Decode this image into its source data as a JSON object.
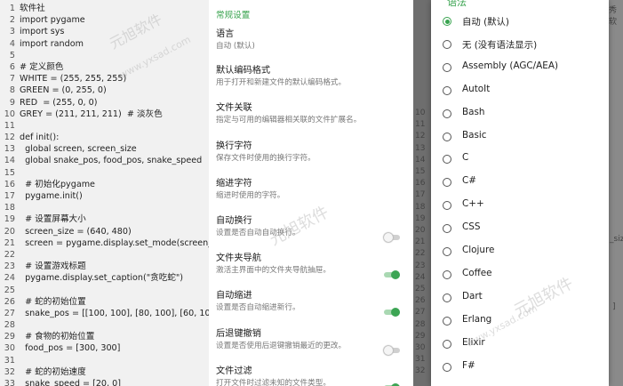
{
  "editor": {
    "lines": [
      {
        "n": "1",
        "t": "软件社"
      },
      {
        "n": "2",
        "t": "import pygame"
      },
      {
        "n": "3",
        "t": "import sys"
      },
      {
        "n": "4",
        "t": "import random"
      },
      {
        "n": "5",
        "t": ""
      },
      {
        "n": "6",
        "t": "# 定义颜色"
      },
      {
        "n": "7",
        "t": "WHITE = (255, 255, 255)"
      },
      {
        "n": "8",
        "t": "GREEN = (0, 255, 0)"
      },
      {
        "n": "9",
        "t": "RED  = (255, 0, 0)"
      },
      {
        "n": "10",
        "t": "GREY = (211, 211, 211)  # 淡灰色"
      },
      {
        "n": "11",
        "t": ""
      },
      {
        "n": "12",
        "t": "def init():"
      },
      {
        "n": "13",
        "t": "  global screen, screen_size"
      },
      {
        "n": "14",
        "t": "  global snake_pos, food_pos, snake_speed"
      },
      {
        "n": "15",
        "t": ""
      },
      {
        "n": "16",
        "t": "  # 初始化pygame"
      },
      {
        "n": "17",
        "t": "  pygame.init()"
      },
      {
        "n": "18",
        "t": ""
      },
      {
        "n": "19",
        "t": "  # 设置屏幕大小"
      },
      {
        "n": "20",
        "t": "  screen_size = (640, 480)"
      },
      {
        "n": "21",
        "t": "  screen = pygame.display.set_mode(screen_siz"
      },
      {
        "n": "22",
        "t": ""
      },
      {
        "n": "23",
        "t": "  # 设置游戏标题"
      },
      {
        "n": "24",
        "t": "  pygame.display.set_caption(\"贪吃蛇\")"
      },
      {
        "n": "25",
        "t": ""
      },
      {
        "n": "26",
        "t": "  # 蛇的初始位置"
      },
      {
        "n": "27",
        "t": "  snake_pos = [[100, 100], [80, 100], [60, 100]]"
      },
      {
        "n": "28",
        "t": ""
      },
      {
        "n": "29",
        "t": "  # 食物的初始位置"
      },
      {
        "n": "30",
        "t": "  food_pos = [300, 300]"
      },
      {
        "n": "31",
        "t": ""
      },
      {
        "n": "32",
        "t": "  # 蛇的初始速度"
      },
      {
        "n": "33",
        "t": "  snake_speed = [20, 0]"
      }
    ]
  },
  "settings": {
    "section": "常规设置",
    "items": [
      {
        "title": "语言",
        "desc": "自动 (默认)",
        "toggle": null
      },
      {
        "title": "默认编码格式",
        "desc": "用于打开和新建文件的默认编码格式。",
        "toggle": null
      },
      {
        "title": "文件关联",
        "desc": "指定与可用的编辑器相关联的文件扩展名。",
        "toggle": null
      },
      {
        "title": "换行字符",
        "desc": "保存文件时使用的换行字符。",
        "toggle": null
      },
      {
        "title": "缩进字符",
        "desc": "缩进时使用的字符。",
        "toggle": null
      },
      {
        "title": "自动换行",
        "desc": "设置是否自动自动换行。",
        "toggle": "off"
      },
      {
        "title": "文件夹导航",
        "desc": "激活主界面中的文件夹导航抽屉。",
        "toggle": "on"
      },
      {
        "title": "自动缩进",
        "desc": "设置是否自动缩进新行。",
        "toggle": "on"
      },
      {
        "title": "后退键撤销",
        "desc": "设置是否使用后退键撤销最近的更改。",
        "toggle": "off"
      },
      {
        "title": "文件过滤",
        "desc": "打开文件时过滤未知的文件类型。",
        "toggle": "on"
      }
    ]
  },
  "background": {
    "gutter_numbers": [
      "10",
      "11",
      "12",
      "13",
      "14",
      "15",
      "16",
      "17",
      "18",
      "19",
      "20",
      "21",
      "22",
      "23",
      "24",
      "25",
      "26",
      "27",
      "28",
      "29",
      "30",
      "31",
      "32"
    ],
    "right_fragments": [
      "秀软",
      "_siz",
      "]"
    ]
  },
  "dialog": {
    "title": "语法",
    "selected_index": 0,
    "options": [
      "自动 (默认)",
      "无 (没有语法显示)",
      "Assembly (AGC/AEA)",
      "AutoIt",
      "Bash",
      "Basic",
      "C",
      "C#",
      "C++",
      "CSS",
      "Clojure",
      "Coffee",
      "Dart",
      "Erlang",
      "Elixir",
      "F#"
    ]
  },
  "colors": {
    "accent": "#38a34e",
    "toggle_on": "#3ca554"
  },
  "watermark": {
    "text": "元旭软件",
    "url": "www.yxsad.com"
  }
}
